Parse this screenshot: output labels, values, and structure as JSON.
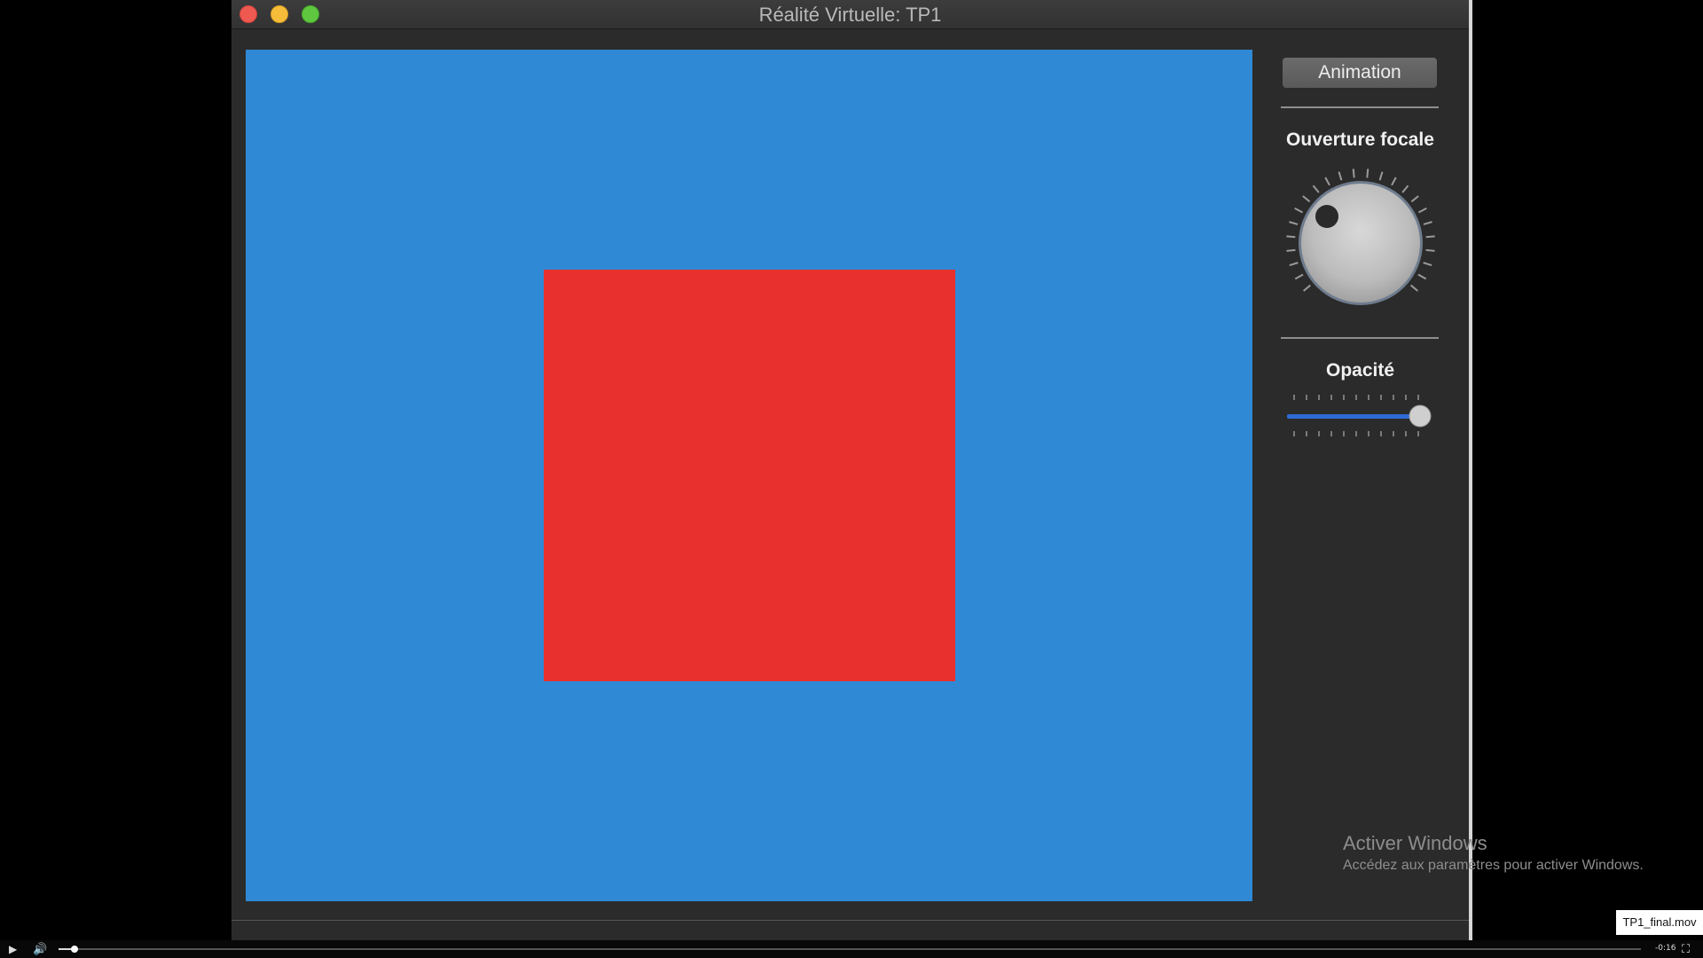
{
  "window": {
    "title": "Réalité Virtuelle: TP1",
    "buttons": [
      "close",
      "minimize",
      "zoom"
    ]
  },
  "viewport": {
    "background_color": "#2f89d4",
    "square_color": "#e8302f"
  },
  "controls": {
    "animation_label": "Animation",
    "focal_label": "Ouverture focale",
    "opacity_label": "Opacité",
    "opacity_level": 1.0
  },
  "overlay": {
    "activate_title": "Activer Windows",
    "activate_sub": "Accédez aux paramètres pour activer Windows.",
    "file_name": "TP1_final.mov"
  },
  "player": {
    "play_icon": "play-icon",
    "volume_icon": "speaker-icon",
    "progress": 0.01,
    "time": "-0:16",
    "fullscreen_icon": "fullscreen-icon"
  }
}
